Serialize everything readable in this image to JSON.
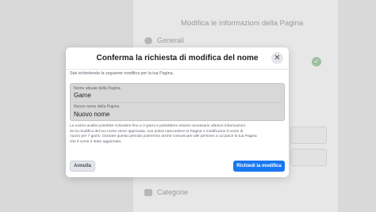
{
  "background": {
    "title": "Modifica le informazioni della Pagina",
    "section_general": "Generali",
    "section_categories": "Categorie",
    "general_icon": "info-icon",
    "categories_icon": "category-icon",
    "check_icon": "check-icon"
  },
  "dialog": {
    "title": "Conferma la richiesta di modifica del nome",
    "close_icon": "close-icon",
    "intro": "Stai richiedendo la seguente modifica per la tua Pagina.",
    "current_name_label": "Nome attuale della Pagina",
    "current_name_value": "Game",
    "new_name_label": "Nuovo nome della Pagina",
    "new_name_value": "Nuovo nome",
    "info_lines": [
      "La nostra analisi potrebbe richiedere fino a 3 giorni e potrebbero essere necessarie ulteriori informazioni.",
      "Se la modifica del tuo nome viene approvata, non potrai nasconderе la Pagina o modificarne il nome di",
      "nuovo per 7 giorni. Durante questo periodo potremmo anche comunicare alle persone a cui piace la tua Pagina",
      "che il nome è stato aggiornato."
    ],
    "cancel_label": "Annulla",
    "confirm_label": "Richiedi la modifica"
  },
  "colors": {
    "primary": "#1877f2",
    "secondary_button": "#e4e6eb"
  }
}
